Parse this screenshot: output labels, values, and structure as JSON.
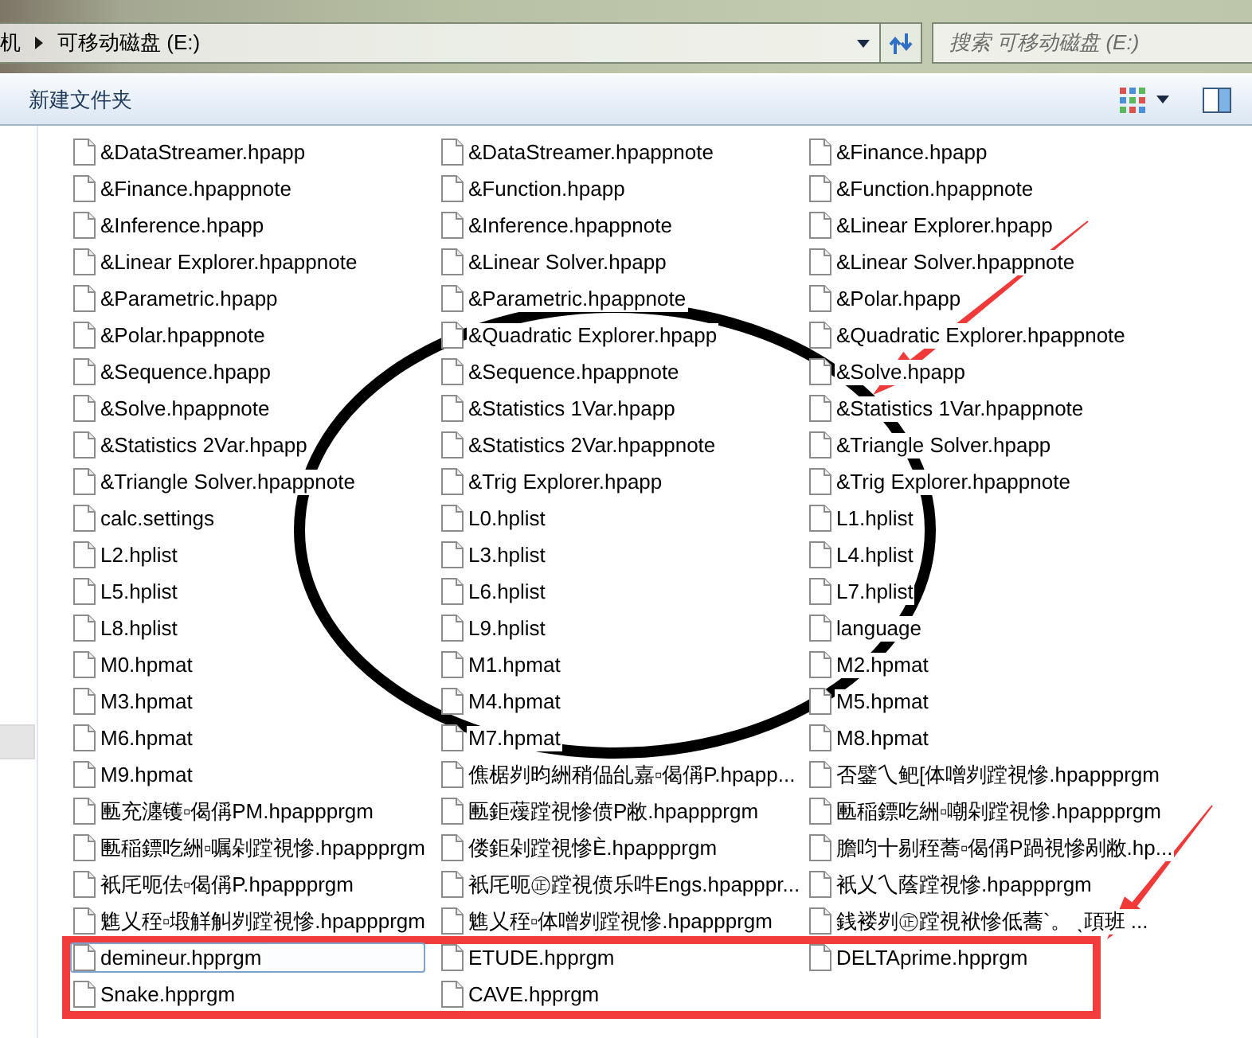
{
  "address_bar": {
    "path": [
      {
        "label": "机"
      },
      {
        "label": "可移动磁盘 (E:)"
      }
    ]
  },
  "search": {
    "placeholder": "搜索 可移动磁盘 (E:)"
  },
  "toolbar": {
    "new_folder": "新建文件夹"
  },
  "files": [
    {
      "name": "&DataStreamer.hpapp",
      "selected": false
    },
    {
      "name": "&Finance.hpappnote",
      "selected": false
    },
    {
      "name": "&Inference.hpapp",
      "selected": false
    },
    {
      "name": "&Linear Explorer.hpappnote",
      "selected": false
    },
    {
      "name": "&Parametric.hpapp",
      "selected": false
    },
    {
      "name": "&Polar.hpappnote",
      "selected": false
    },
    {
      "name": "&Sequence.hpapp",
      "selected": false
    },
    {
      "name": "&Solve.hpappnote",
      "selected": false
    },
    {
      "name": "&Statistics 2Var.hpapp",
      "selected": false
    },
    {
      "name": "&Triangle Solver.hpappnote",
      "selected": false
    },
    {
      "name": "calc.settings",
      "selected": false
    },
    {
      "name": "L2.hplist",
      "selected": false
    },
    {
      "name": "L5.hplist",
      "selected": false
    },
    {
      "name": "L8.hplist",
      "selected": false
    },
    {
      "name": "M0.hpmat",
      "selected": false
    },
    {
      "name": "M3.hpmat",
      "selected": false
    },
    {
      "name": "M6.hpmat",
      "selected": false
    },
    {
      "name": "M9.hpmat",
      "selected": false
    },
    {
      "name": "匭充瀍镬▫偈偁PM.hpappprgm",
      "selected": false
    },
    {
      "name": "匭稲鏢吃絒▫嘱剁蹚視慘.hpappprgm",
      "selected": false
    },
    {
      "name": "衹厇呃佉▫偈偁P.hpappprgm",
      "selected": false
    },
    {
      "name": "魋乂秷▫塅觧觓刿蹚視慘.hpappprgm",
      "selected": false
    },
    {
      "name": "demineur.hpprgm",
      "selected": true
    },
    {
      "name": "Snake.hpprgm",
      "selected": false
    },
    {
      "name": "&DataStreamer.hpappnote",
      "selected": false
    },
    {
      "name": "&Function.hpapp",
      "selected": false
    },
    {
      "name": "&Inference.hpappnote",
      "selected": false
    },
    {
      "name": "&Linear Solver.hpapp",
      "selected": false
    },
    {
      "name": "&Parametric.hpappnote",
      "selected": false
    },
    {
      "name": "&Quadratic Explorer.hpapp",
      "selected": false
    },
    {
      "name": "&Sequence.hpappnote",
      "selected": false
    },
    {
      "name": "&Statistics 1Var.hpapp",
      "selected": false
    },
    {
      "name": "&Statistics 2Var.hpappnote",
      "selected": false
    },
    {
      "name": "&Trig Explorer.hpapp",
      "selected": false
    },
    {
      "name": "L0.hplist",
      "selected": false
    },
    {
      "name": "L3.hplist",
      "selected": false
    },
    {
      "name": "L6.hplist",
      "selected": false
    },
    {
      "name": "L9.hplist",
      "selected": false
    },
    {
      "name": "M1.hpmat",
      "selected": false
    },
    {
      "name": "M4.hpmat",
      "selected": false
    },
    {
      "name": "M7.hpmat",
      "selected": false
    },
    {
      "name": "僬椐刿昀絒稍偘乨嘉▫偈偁P.hpapp...",
      "selected": false
    },
    {
      "name": "匭鉅蕿蹚視慘偾P敝.hpappprgm",
      "selected": false
    },
    {
      "name": "偻鉅剁蹚視慘È.hpappprgm",
      "selected": false
    },
    {
      "name": "衹厇呃㊣蹚視偾乐吽Engs.hpapppr...",
      "selected": false
    },
    {
      "name": "魋乂秷▫体噌刿蹚視慘.hpappprgm",
      "selected": false
    },
    {
      "name": "ETUDE.hpprgm",
      "selected": false
    },
    {
      "name": "CAVE.hpprgm",
      "selected": false
    },
    {
      "name": "&Finance.hpapp",
      "selected": false
    },
    {
      "name": "&Function.hpappnote",
      "selected": false
    },
    {
      "name": "&Linear Explorer.hpapp",
      "selected": false
    },
    {
      "name": "&Linear Solver.hpappnote",
      "selected": false
    },
    {
      "name": "&Polar.hpapp",
      "selected": false
    },
    {
      "name": "&Quadratic Explorer.hpappnote",
      "selected": false
    },
    {
      "name": "&Solve.hpapp",
      "selected": false
    },
    {
      "name": "&Statistics 1Var.hpappnote",
      "selected": false
    },
    {
      "name": "&Triangle Solver.hpapp",
      "selected": false
    },
    {
      "name": "&Trig Explorer.hpappnote",
      "selected": false
    },
    {
      "name": "L1.hplist",
      "selected": false
    },
    {
      "name": "L4.hplist",
      "selected": false
    },
    {
      "name": "L7.hplist",
      "selected": false
    },
    {
      "name": "language",
      "selected": false
    },
    {
      "name": "M2.hpmat",
      "selected": false
    },
    {
      "name": "M5.hpmat",
      "selected": false
    },
    {
      "name": "M8.hpmat",
      "selected": false
    },
    {
      "name": "否鐾乀鲃[体噌刿蹚視慘.hpappprgm",
      "selected": false
    },
    {
      "name": "匭稲鏢吃絒▫嘲剁蹚視慘.hpappprgm",
      "selected": false
    },
    {
      "name": "膽呁十剔秷蕎▫偈偁P踻視慘剐敝.hp...",
      "selected": false
    },
    {
      "name": "衹乂乀蔭蹚視慘.hpappprgm",
      "selected": false
    },
    {
      "name": "銭褛刿㊣蹚視袱慘低蕎`。 ˎ頙班 ...",
      "selected": false
    },
    {
      "name": "DELTAprime.hpprgm",
      "selected": false
    }
  ]
}
